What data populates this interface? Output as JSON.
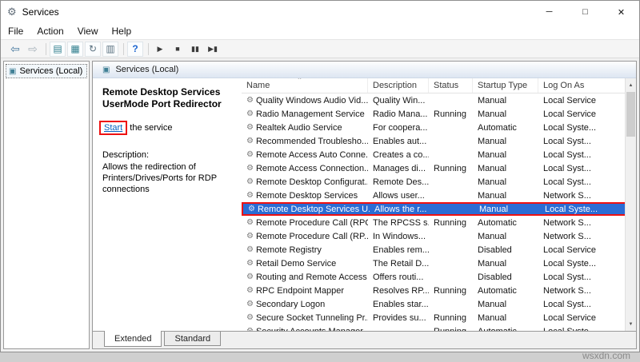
{
  "window": {
    "title": "Services",
    "controls": {
      "minimize": "─",
      "maximize": "□",
      "close": "✕"
    }
  },
  "icons": {
    "app": "⚙",
    "console": "▣",
    "gear": "⚙",
    "scroll_up": "▲",
    "scroll_down": "▼",
    "sort_ascending": "^"
  },
  "menu": {
    "items": [
      "File",
      "Action",
      "View",
      "Help"
    ]
  },
  "toolbar": {
    "groups": [
      [
        {
          "name": "back-icon",
          "glyph": "⇦",
          "cls": "blue"
        },
        {
          "name": "forward-icon",
          "glyph": "⇨",
          "cls": "dim"
        }
      ],
      [
        {
          "name": "show-console-tree-icon",
          "glyph": "▤",
          "cls": "teal"
        },
        {
          "name": "properties-icon",
          "glyph": "▦",
          "cls": "teal"
        },
        {
          "name": "refresh-icon",
          "glyph": "↻",
          "cls": "plain"
        },
        {
          "name": "export-list-icon",
          "glyph": "▥",
          "cls": "plain"
        }
      ],
      [
        {
          "name": "help-icon",
          "glyph": "?",
          "cls": "help"
        }
      ],
      [
        {
          "name": "start-service-icon",
          "glyph": "▶",
          "cls": "media"
        },
        {
          "name": "stop-service-icon",
          "glyph": "■",
          "cls": "media"
        },
        {
          "name": "pause-service-icon",
          "glyph": "▮▮",
          "cls": "media"
        },
        {
          "name": "restart-service-icon",
          "glyph": "▶▮",
          "cls": "media"
        }
      ]
    ]
  },
  "tree": {
    "root_label": "Services (Local)"
  },
  "pane_header": {
    "title": "Services (Local)"
  },
  "detail_panel": {
    "service_name": "Remote Desktop Services UserMode Port Redirector",
    "start_link": "Start",
    "start_suffix": " the service",
    "description_label": "Description:",
    "description_text": "Allows the redirection of Printers/Drives/Ports for RDP connections"
  },
  "table": {
    "columns": [
      "Name",
      "Description",
      "Status",
      "Startup Type",
      "Log On As"
    ],
    "rows": [
      {
        "name": "Quality Windows Audio Vid...",
        "description": "Quality Win...",
        "status": "",
        "startup": "Manual",
        "logon": "Local Service",
        "selected": false
      },
      {
        "name": "Radio Management Service",
        "description": "Radio Mana...",
        "status": "Running",
        "startup": "Manual",
        "logon": "Local Service",
        "selected": false
      },
      {
        "name": "Realtek Audio Service",
        "description": "For coopera...",
        "status": "",
        "startup": "Automatic",
        "logon": "Local Syste...",
        "selected": false
      },
      {
        "name": "Recommended Troublesho...",
        "description": "Enables aut...",
        "status": "",
        "startup": "Manual",
        "logon": "Local Syst...",
        "selected": false
      },
      {
        "name": "Remote Access Auto Conne...",
        "description": "Creates a co...",
        "status": "",
        "startup": "Manual",
        "logon": "Local Syst...",
        "selected": false
      },
      {
        "name": "Remote Access Connection...",
        "description": "Manages di...",
        "status": "Running",
        "startup": "Manual",
        "logon": "Local Syst...",
        "selected": false
      },
      {
        "name": "Remote Desktop Configurat...",
        "description": "Remote Des...",
        "status": "",
        "startup": "Manual",
        "logon": "Local Syst...",
        "selected": false
      },
      {
        "name": "Remote Desktop Services",
        "description": "Allows user...",
        "status": "",
        "startup": "Manual",
        "logon": "Network S...",
        "selected": false
      },
      {
        "name": "Remote Desktop Services U...",
        "description": "Allows the r...",
        "status": "",
        "startup": "Manual",
        "logon": "Local Syste...",
        "selected": true
      },
      {
        "name": "Remote Procedure Call (RPC)",
        "description": "The RPCSS s...",
        "status": "Running",
        "startup": "Automatic",
        "logon": "Network S...",
        "selected": false
      },
      {
        "name": "Remote Procedure Call (RP...",
        "description": "In Windows...",
        "status": "",
        "startup": "Manual",
        "logon": "Network S...",
        "selected": false
      },
      {
        "name": "Remote Registry",
        "description": "Enables rem...",
        "status": "",
        "startup": "Disabled",
        "logon": "Local Service",
        "selected": false
      },
      {
        "name": "Retail Demo Service",
        "description": "The Retail D...",
        "status": "",
        "startup": "Manual",
        "logon": "Local Syste...",
        "selected": false
      },
      {
        "name": "Routing and Remote Access",
        "description": "Offers routi...",
        "status": "",
        "startup": "Disabled",
        "logon": "Local Syst...",
        "selected": false
      },
      {
        "name": "RPC Endpoint Mapper",
        "description": "Resolves RP...",
        "status": "Running",
        "startup": "Automatic",
        "logon": "Network S...",
        "selected": false
      },
      {
        "name": "Secondary Logon",
        "description": "Enables star...",
        "status": "",
        "startup": "Manual",
        "logon": "Local Syst...",
        "selected": false
      },
      {
        "name": "Secure Socket Tunneling Pr...",
        "description": "Provides su...",
        "status": "Running",
        "startup": "Manual",
        "logon": "Local Service",
        "selected": false
      },
      {
        "name": "Security Accounts Manager",
        "description": "",
        "status": "Running",
        "startup": "Automatic",
        "logon": "Local Syste...",
        "selected": false
      }
    ]
  },
  "tabs": {
    "items": [
      "Extended",
      "Standard"
    ],
    "active_index": 0
  },
  "colors": {
    "selection": "#2b6cd4",
    "annotation_red": "#ee1111",
    "link_blue": "#0563c1"
  },
  "watermark": "wsxdn.com"
}
